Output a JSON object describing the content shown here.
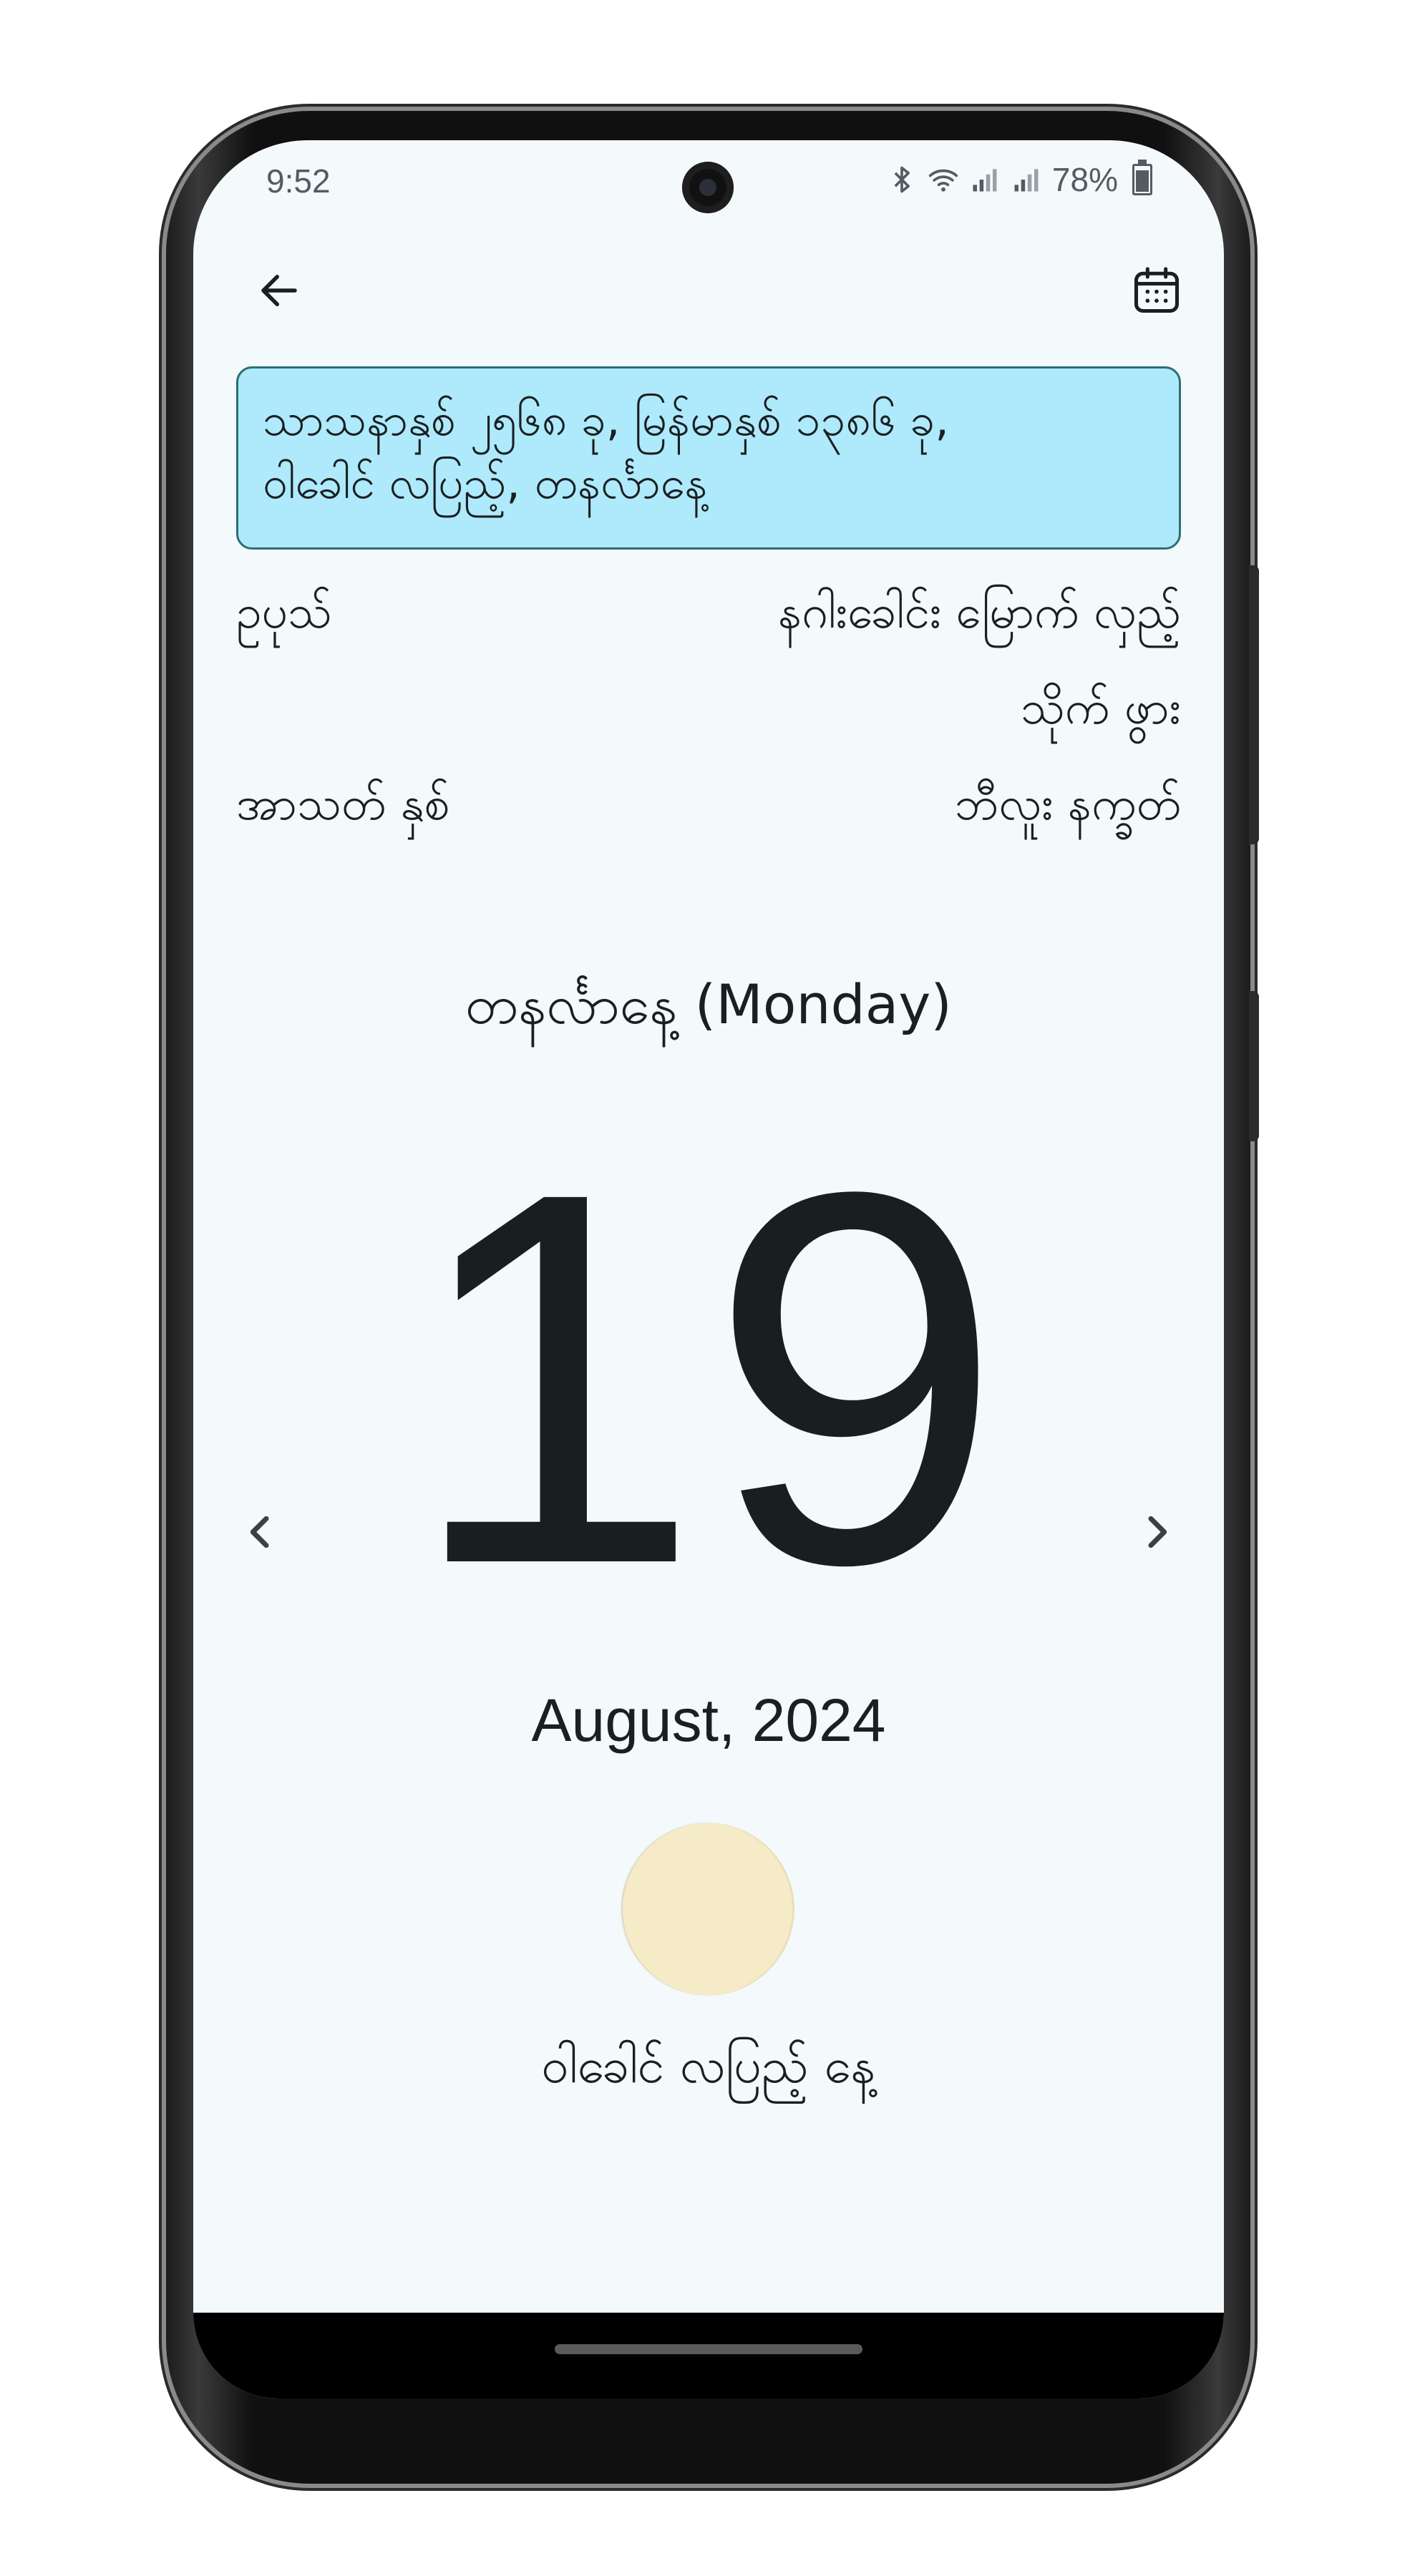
{
  "status_bar": {
    "time": "9:52",
    "battery_percent": "78%",
    "icons": [
      "bluetooth-icon",
      "wifi-icon",
      "signal-icon",
      "signal-icon",
      "battery-icon"
    ]
  },
  "app_bar": {
    "back_icon": "arrow-left-icon",
    "calendar_icon": "calendar-icon"
  },
  "banner": {
    "line1": "သာသနာနှစ် ၂၅၆၈ ခု, မြန်မာနှစ် ၁၃၈၆ ခု,",
    "line2": "ဝါခေါင် လပြည့်, တနင်္လာနေ့"
  },
  "details": {
    "left1": "ဥပုသ်",
    "right1": "နဂါးခေါင်း မြောက် လှည့်",
    "right2": "သိုက် ဖွား",
    "left3": "အာသတ် နှစ်",
    "right3": "ဘီလူး နက္ခတ်"
  },
  "weekday": "တနင်္လာနေ့ (Monday)",
  "day_number": "19",
  "month_year": "August, 2024",
  "moon": {
    "phase": "full",
    "color": "#f6ebc7",
    "label": "ဝါခေါင် လပြည့် နေ့"
  },
  "colors": {
    "background": "#f4f9fc",
    "banner_bg": "#aeeafb",
    "banner_border": "#2b6f73",
    "text": "#1a1f22"
  }
}
